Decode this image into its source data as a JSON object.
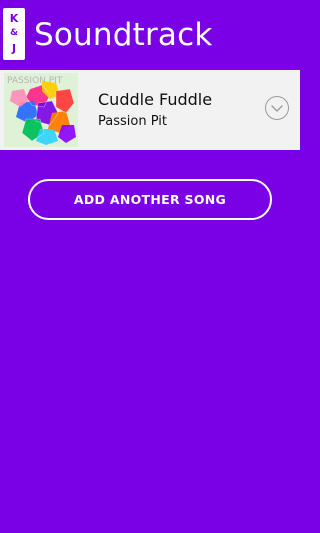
{
  "header": {
    "logo": {
      "line1": "K",
      "line2": "&",
      "line3": "J"
    },
    "title": "Soundtrack"
  },
  "song": {
    "title": "Cuddle Fuddle",
    "artist": "Passion Pit",
    "album_art": {
      "text": "PASSION PIT"
    }
  },
  "actions": {
    "add_another_song": "ADD ANOTHER SONG"
  },
  "colors": {
    "background": "#7a00e6",
    "row_background": "#f2f2f2",
    "text_light": "#ffffff",
    "text_dark": "#111111"
  }
}
